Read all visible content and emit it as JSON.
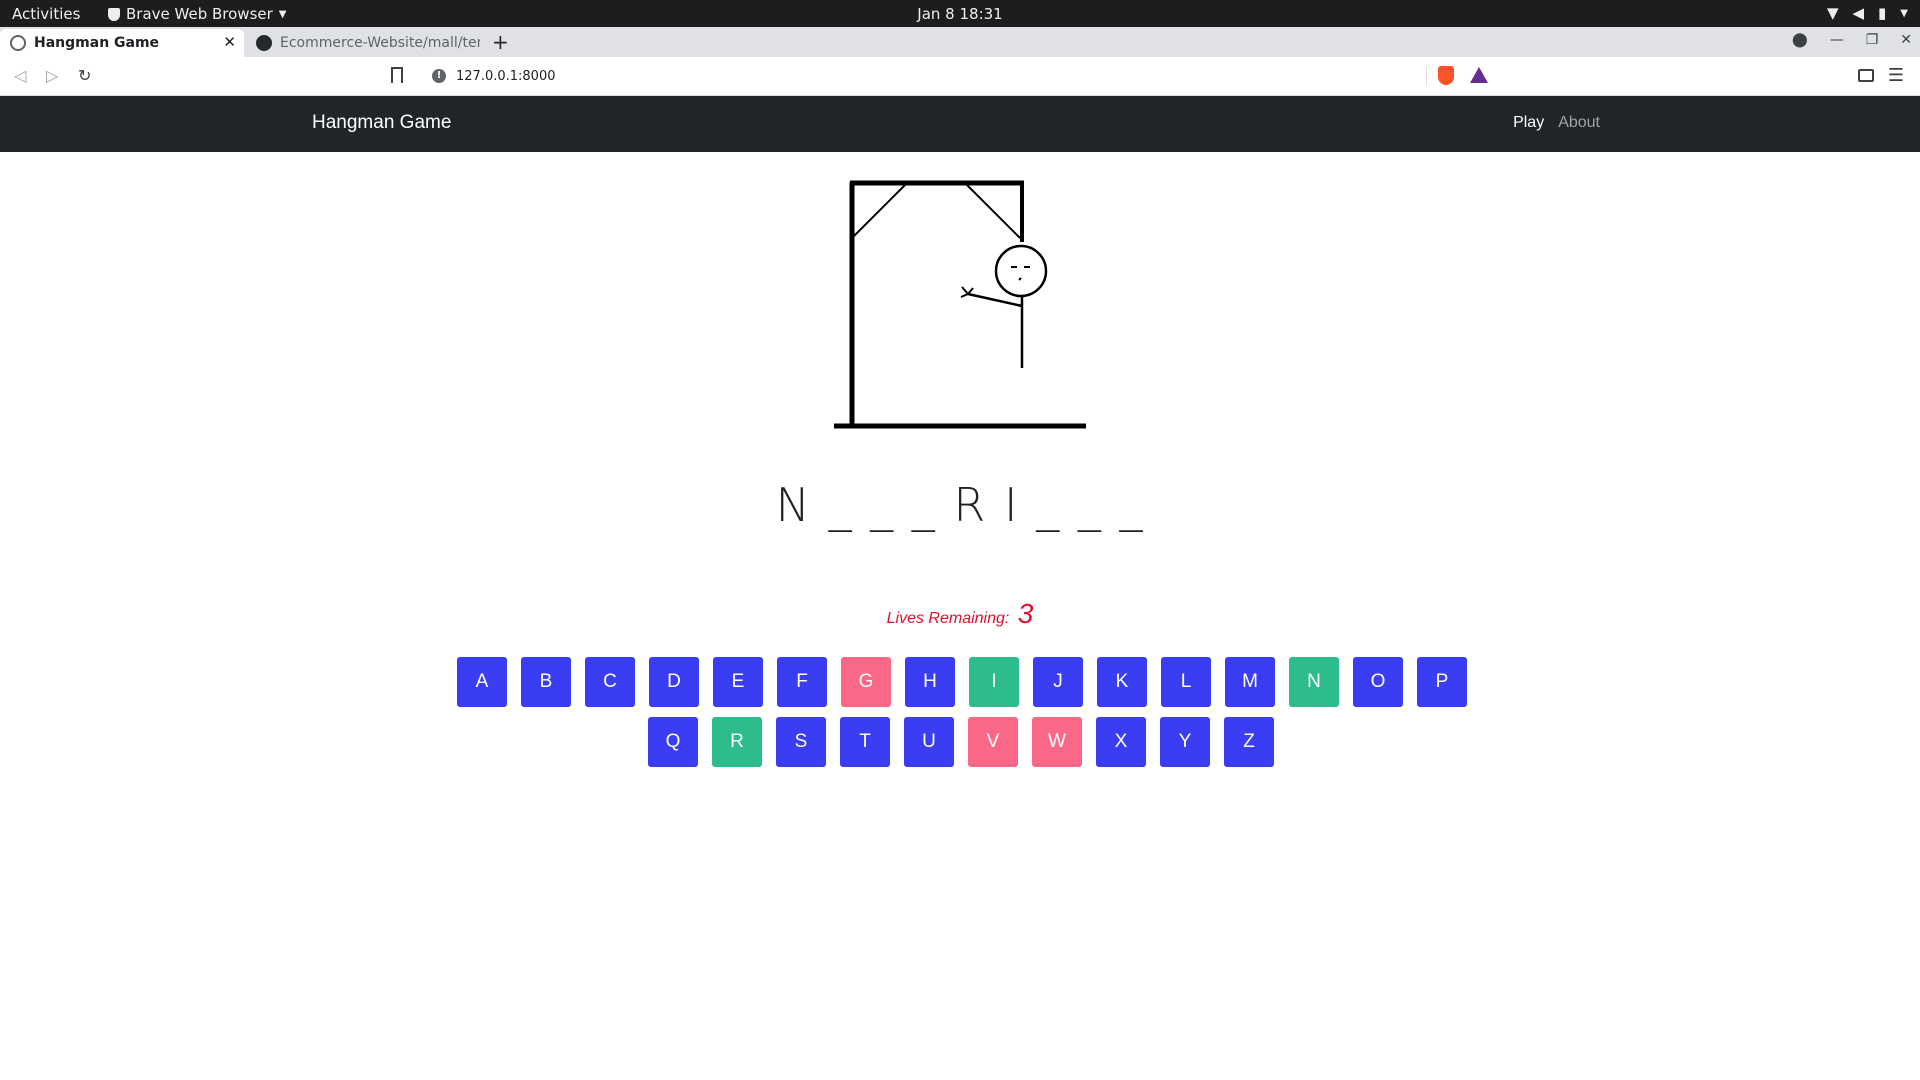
{
  "os": {
    "activities": "Activities",
    "app_name": "Brave Web Browser",
    "clock": "Jan 8  18:31"
  },
  "browser": {
    "tabs": [
      {
        "title": "Hangman Game",
        "active": true
      },
      {
        "title": "Ecommerce-Website/mall/ten",
        "active": false
      }
    ],
    "url": "127.0.0.1:8000"
  },
  "site": {
    "brand": "Hangman Game",
    "nav": [
      {
        "label": "Play",
        "active": true
      },
      {
        "label": "About",
        "active": false
      }
    ]
  },
  "game": {
    "word_display": "N _ _ _ R I _ _ _",
    "lives_label": "Lives Remaining:",
    "lives_remaining": "3",
    "keyboard_rows": [
      [
        {
          "letter": "A",
          "state": "unused"
        },
        {
          "letter": "B",
          "state": "unused"
        },
        {
          "letter": "C",
          "state": "unused"
        },
        {
          "letter": "D",
          "state": "unused"
        },
        {
          "letter": "E",
          "state": "unused"
        },
        {
          "letter": "F",
          "state": "unused"
        },
        {
          "letter": "G",
          "state": "wrong"
        },
        {
          "letter": "H",
          "state": "unused"
        },
        {
          "letter": "I",
          "state": "correct"
        },
        {
          "letter": "J",
          "state": "unused"
        },
        {
          "letter": "K",
          "state": "unused"
        },
        {
          "letter": "L",
          "state": "unused"
        },
        {
          "letter": "M",
          "state": "unused"
        },
        {
          "letter": "N",
          "state": "correct"
        },
        {
          "letter": "O",
          "state": "unused"
        },
        {
          "letter": "P",
          "state": "unused"
        }
      ],
      [
        {
          "letter": "Q",
          "state": "unused"
        },
        {
          "letter": "R",
          "state": "correct"
        },
        {
          "letter": "S",
          "state": "unused"
        },
        {
          "letter": "T",
          "state": "unused"
        },
        {
          "letter": "U",
          "state": "unused"
        },
        {
          "letter": "V",
          "state": "wrong"
        },
        {
          "letter": "W",
          "state": "wrong"
        },
        {
          "letter": "X",
          "state": "unused"
        },
        {
          "letter": "Y",
          "state": "unused"
        },
        {
          "letter": "Z",
          "state": "unused"
        }
      ]
    ],
    "colors": {
      "unused": "#3a3df2",
      "correct": "#2ebb8d",
      "wrong": "#fb6887",
      "lives": "#e0102b"
    }
  }
}
